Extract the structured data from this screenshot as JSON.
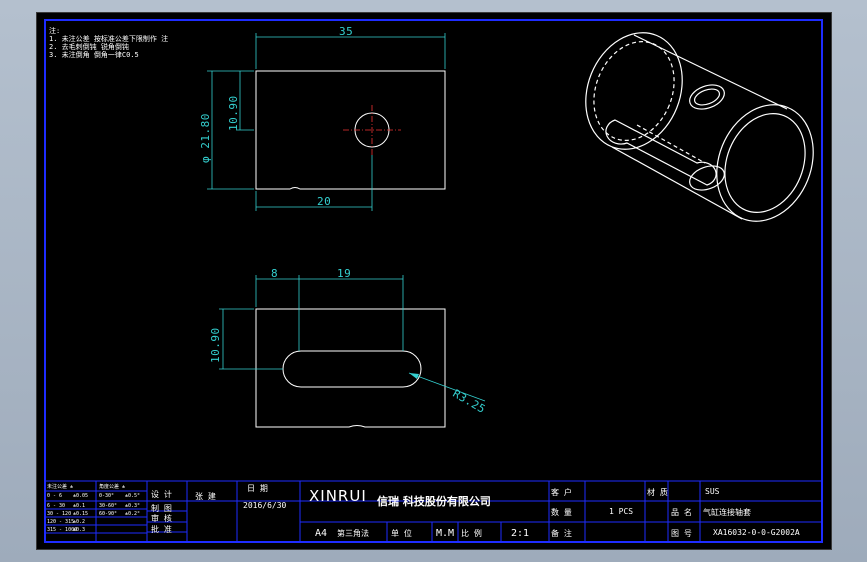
{
  "notes": {
    "line0": "注:",
    "line1": "1. 未注公差 按标准公差下限制作 注",
    "line2": "2. 去毛刺倒钝 锐角倒钝",
    "line3": "3. 未注倒角 倒角一律C0.5"
  },
  "dimensions": {
    "top_width": "35",
    "top_hole_offset": "20",
    "top_hole_height": "10.90",
    "top_diameter": "φ 21.80",
    "bottom_slot_offset": "8",
    "bottom_slot_length": "19",
    "bottom_slot_height": "10.90",
    "bottom_radius": "R3.25"
  },
  "title_block": {
    "company_en": "XINRUI",
    "company_cn": "信瑞 科技股份有限公司",
    "date": "2016/6/30",
    "designer": "设 计",
    "drawer": "制 图",
    "checker": "审 核",
    "approver": "批 准",
    "sign": "张 建",
    "date_label": "日 期",
    "paper": "A4",
    "view": "第三角法",
    "unit_label": "单 位",
    "unit": "M.M",
    "scale_label": "比 例",
    "scale": "2:1",
    "material_label": "材 质",
    "material": "SUS",
    "qty_label": "数 量",
    "qty": "1  PCS",
    "name_label": "品 名",
    "name": "气缸连接轴套",
    "code_label": "图 号",
    "code": "XA16032-0-0-G2002A",
    "customer_label": "客 户",
    "remark_label": "备 注",
    "tol_header_1": "未注公差 ±",
    "tol_header_2": "角度公差 ±",
    "tol_rows": [
      [
        "0 - 6",
        "±0.05",
        "0-30°",
        "±0.5°"
      ],
      [
        "6 - 30",
        "±0.1",
        "30-60°",
        "±0.3°"
      ],
      [
        "30 - 120",
        "±0.15",
        "60-90°",
        "±0.2°"
      ],
      [
        "120 - 315",
        "±0.2",
        "",
        ""
      ],
      [
        "315 - 1000",
        "±0.3",
        "",
        ""
      ]
    ]
  }
}
